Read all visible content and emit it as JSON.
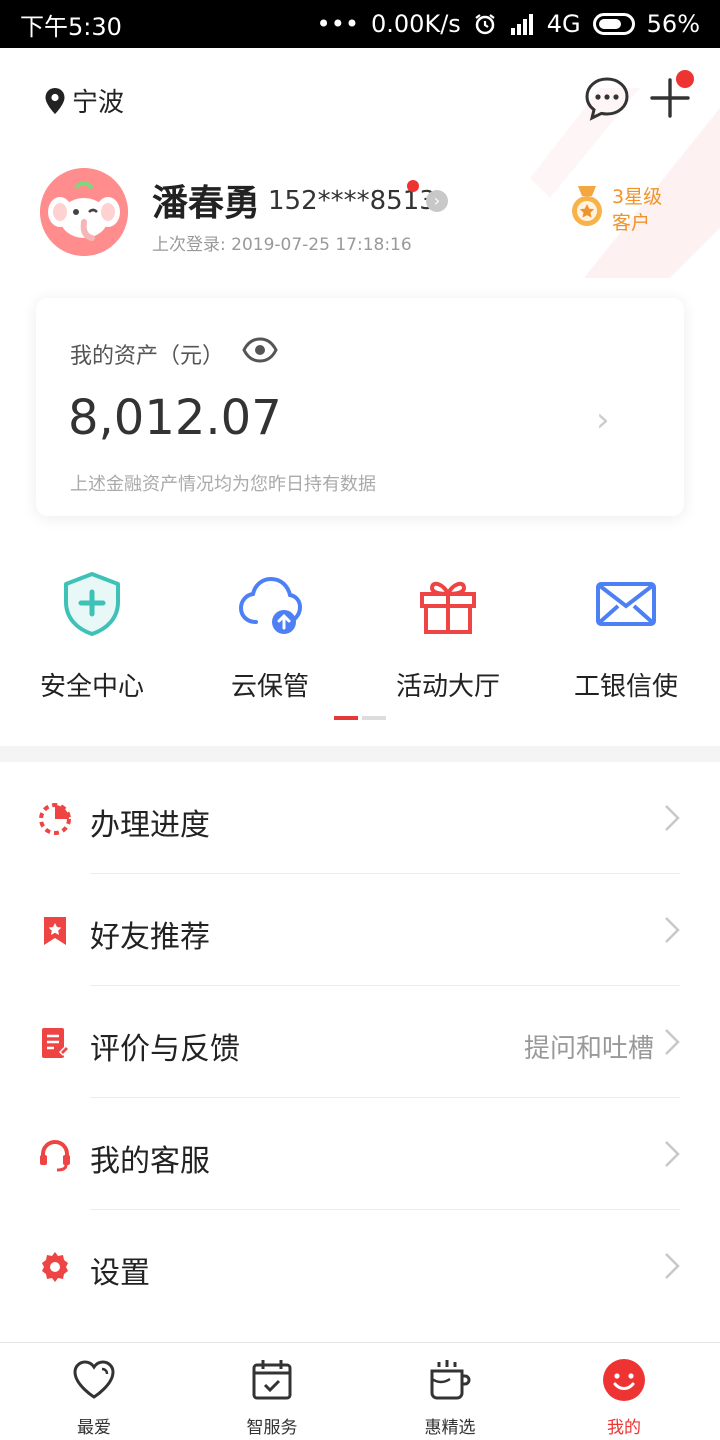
{
  "status_bar": {
    "time": "下午5:30",
    "dots": "•••",
    "speed": "0.00K/s",
    "network": "4G",
    "battery": "56%"
  },
  "header": {
    "location": "宁波",
    "user": {
      "name": "潘春勇",
      "phone": "152****8513",
      "last_login": "上次登录: 2019-07-25 17:18:16"
    },
    "level_line1": "3星级",
    "level_line2": "客户"
  },
  "assets": {
    "title": "我的资产（元）",
    "amount": "8,012.07",
    "note": "上述金融资产情况均为您昨日持有数据"
  },
  "quick_entries": [
    {
      "label": "安全中心",
      "icon": "shield-plus-icon"
    },
    {
      "label": "云保管",
      "icon": "cloud-upload-icon"
    },
    {
      "label": "活动大厅",
      "icon": "gift-icon"
    },
    {
      "label": "工银信使",
      "icon": "mail-icon"
    }
  ],
  "menu": [
    {
      "label": "办理进度",
      "icon": "progress-icon",
      "extra": ""
    },
    {
      "label": "好友推荐",
      "icon": "bookmark-star-icon",
      "extra": ""
    },
    {
      "label": "评价与反馈",
      "icon": "feedback-icon",
      "extra": "提问和吐槽"
    },
    {
      "label": "我的客服",
      "icon": "headset-icon",
      "extra": ""
    },
    {
      "label": "设置",
      "icon": "gear-icon",
      "extra": ""
    }
  ],
  "bottom_nav": [
    {
      "label": "最爱",
      "icon": "heart-icon",
      "active": false
    },
    {
      "label": "智服务",
      "icon": "calendar-check-icon",
      "active": false
    },
    {
      "label": "惠精选",
      "icon": "cup-icon",
      "active": false
    },
    {
      "label": "我的",
      "icon": "smile-icon",
      "active": true
    }
  ],
  "colors": {
    "accent": "#ee3333",
    "teal": "#3ec1b6",
    "blue": "#4d7ff5",
    "orange": "#f0932b"
  }
}
